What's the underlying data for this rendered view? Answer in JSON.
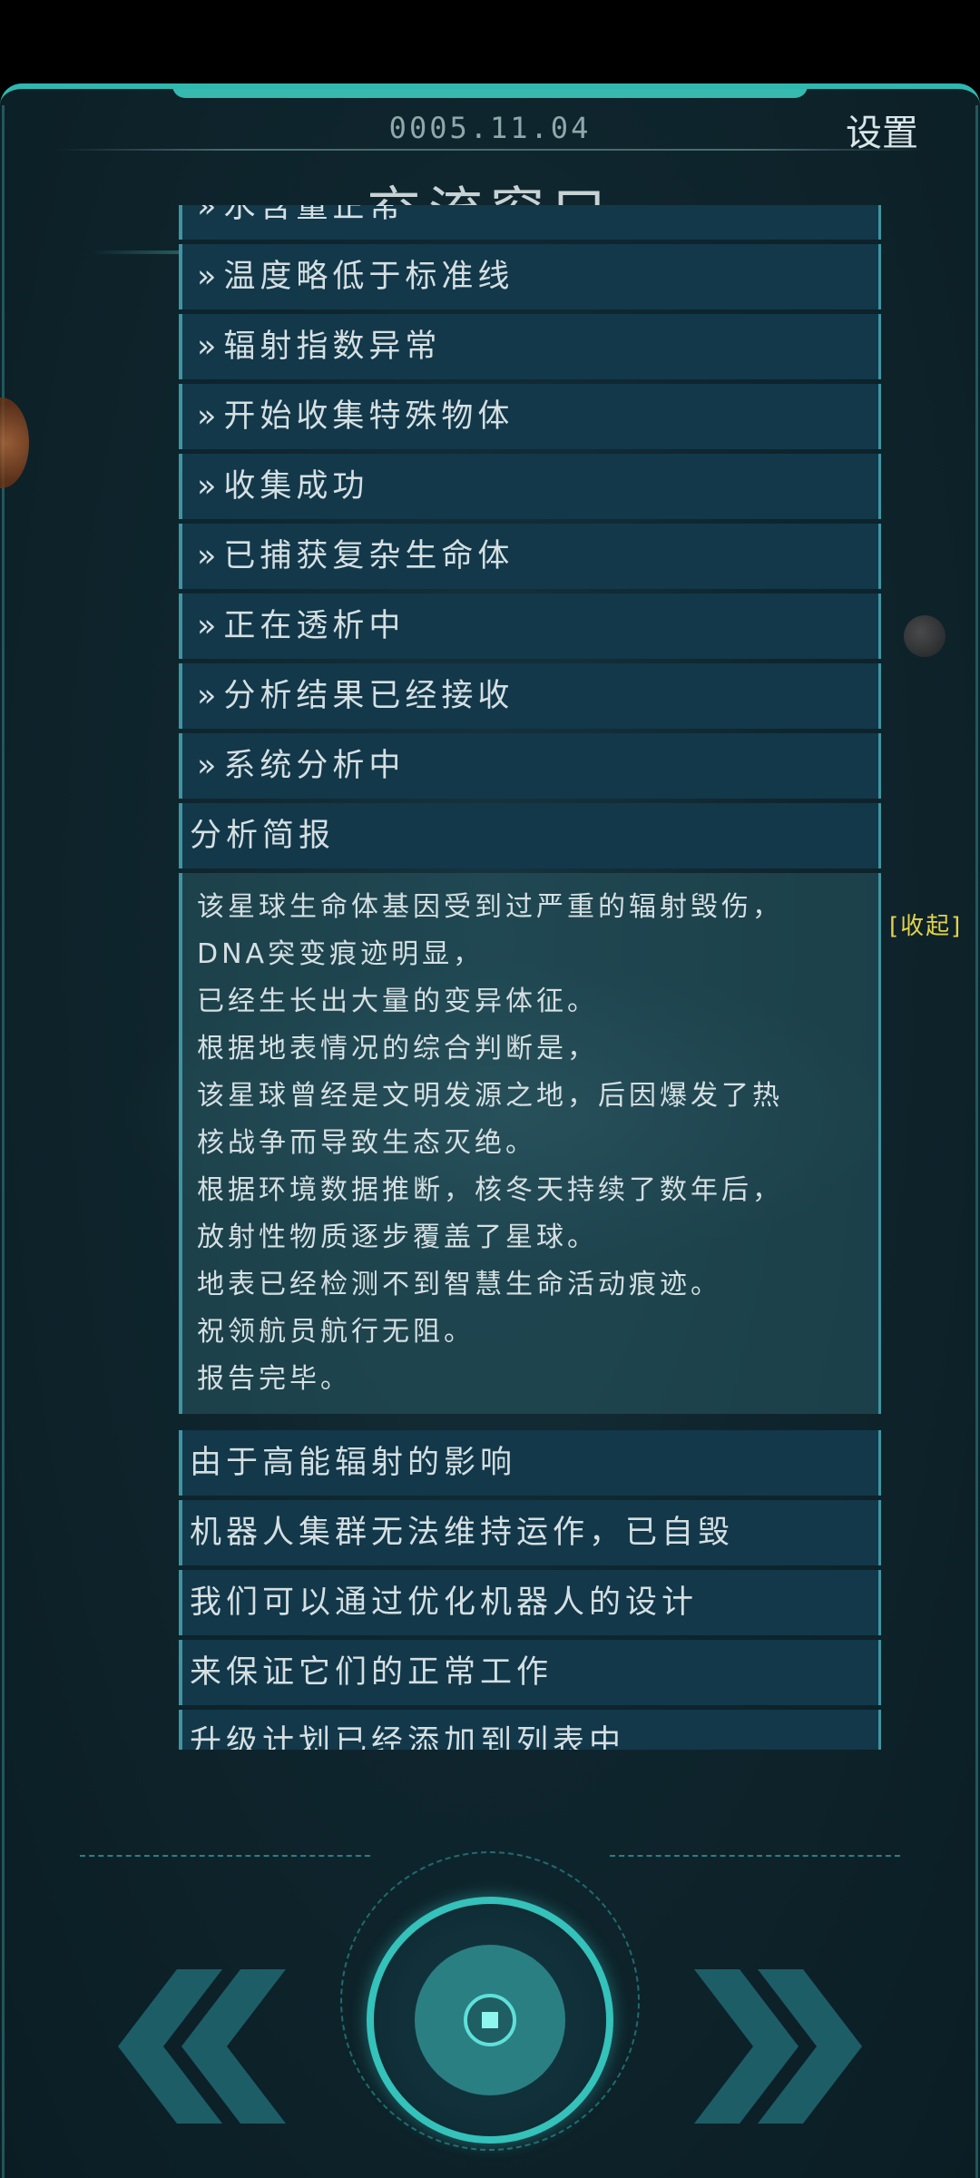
{
  "header": {
    "date": "0005.11.04",
    "settings_label": "设置",
    "title": "交流窗口"
  },
  "log": {
    "items": [
      "水含量正常",
      "温度略低于标准线",
      "辐射指数异常",
      "开始收集特殊物体",
      "收集成功",
      "已捕获复杂生命体",
      "正在透析中",
      "分析结果已经接收",
      "系统分析中"
    ],
    "bullet": "»",
    "report_title": "分析简报",
    "collapse_label": "[收起]",
    "report_lines": [
      "该星球生命体基因受到过严重的辐射毁伤，",
      "DNA突变痕迹明显，",
      "已经生长出大量的变异体征。",
      "根据地表情况的综合判断是，",
      "该星球曾经是文明发源之地，后因爆发了热",
      "核战争而导致生态灭绝。",
      "根据环境数据推断，核冬天持续了数年后，",
      "放射性物质逐步覆盖了星球。",
      "地表已经检测不到智慧生命活动痕迹。",
      "祝领航员航行无阻。",
      "报告完毕。"
    ],
    "after_items": [
      "由于高能辐射的影响",
      "机器人集群无法维持运作，已自毁",
      "我们可以通过优化机器人的设计",
      "来保证它们的正常工作",
      "升级计划已经添加到列表中"
    ]
  },
  "controls": {
    "prev_icon": "double-chevron-left-icon",
    "next_icon": "double-chevron-right-icon",
    "center_icon": "target-icon"
  },
  "colors": {
    "accent": "#34c2bb",
    "panel_item": "#12384a",
    "collapse": "#e3d34a"
  }
}
